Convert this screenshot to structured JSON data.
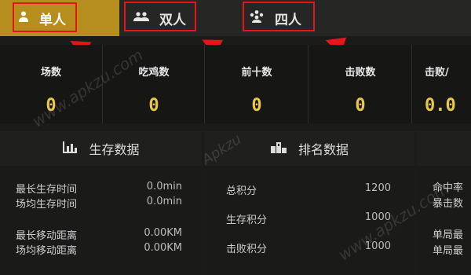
{
  "tabs": [
    {
      "label": "单人",
      "icon": "single-person-icon",
      "active": true
    },
    {
      "label": "双人",
      "icon": "two-person-icon",
      "active": false
    },
    {
      "label": "四人",
      "icon": "four-person-icon",
      "active": false
    }
  ],
  "stats": [
    {
      "label": "场数",
      "value": "0"
    },
    {
      "label": "吃鸡数",
      "value": "0"
    },
    {
      "label": "前十数",
      "value": "0"
    },
    {
      "label": "击败数",
      "value": "0"
    },
    {
      "label": "击败/",
      "value": "0.0"
    }
  ],
  "sections": {
    "survival": {
      "title": "生存数据",
      "icon": "bar-chart-icon",
      "rows": [
        {
          "label": "最长生存时间",
          "value": "0.0min"
        },
        {
          "label": "场均生存时间",
          "value": "0.0min"
        },
        {
          "label": "最长移动距离",
          "value": "0.00KM"
        },
        {
          "label": "场均移动距离",
          "value": "0.00KM"
        }
      ]
    },
    "ranking": {
      "title": "排名数据",
      "icon": "podium-icon",
      "rows": [
        {
          "label": "总积分",
          "value": "1200"
        },
        {
          "label": "生存积分",
          "value": "1000"
        },
        {
          "label": "击败积分",
          "value": "1000"
        }
      ]
    },
    "combat": {
      "rows": [
        {
          "label": "命中率"
        },
        {
          "label": "暴击数"
        },
        {
          "label": "单局最"
        },
        {
          "label": "单局最"
        }
      ]
    }
  },
  "watermarks": [
    "www.apkzu.com",
    "Apkzu",
    "www.apkzu.com"
  ],
  "colors": {
    "accent": "#b58e1d",
    "value": "#e9c74a",
    "highlight": "#e3161c"
  }
}
